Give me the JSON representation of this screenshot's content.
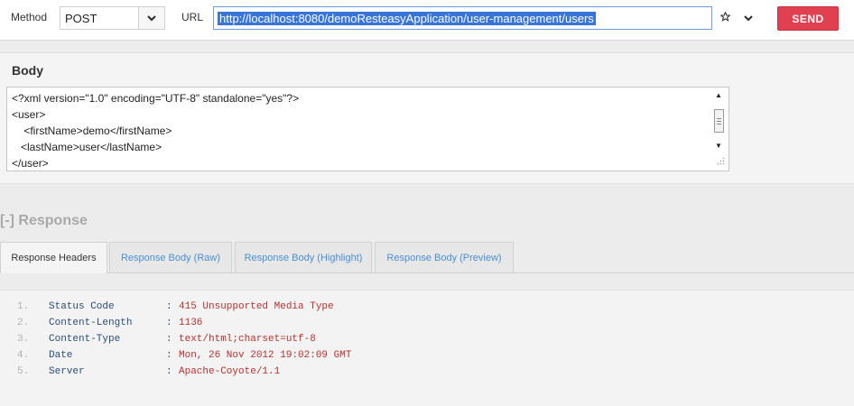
{
  "request": {
    "method_label": "Method",
    "method_value": "POST",
    "url_label": "URL",
    "url_value": "http://localhost:8080/demoResteasyApplication/user-management/users",
    "send_label": "SEND"
  },
  "body": {
    "title": "Body",
    "lines": [
      "<?xml version=\"1.0\" encoding=\"UTF-8\" standalone=\"yes\"?>",
      "<user>",
      "    <firstName>demo</firstName>",
      "   <lastName>user</lastName>",
      "</user>"
    ]
  },
  "response": {
    "title": "[-] Response",
    "tabs": [
      {
        "label": "Response Headers"
      },
      {
        "label": "Response Body (Raw)"
      },
      {
        "label": "Response Body (Highlight)"
      },
      {
        "label": "Response Body (Preview)"
      }
    ],
    "active_tab": "Response Headers",
    "headers": [
      {
        "num": "1.",
        "key": "Status Code",
        "colon": ":",
        "value": "415 Unsupported Media Type"
      },
      {
        "num": "2.",
        "key": "Content-Length",
        "colon": ":",
        "value": "1136"
      },
      {
        "num": "3.",
        "key": "Content-Type",
        "colon": ":",
        "value": "text/html;charset=utf-8"
      },
      {
        "num": "4.",
        "key": "Date",
        "colon": ":",
        "value": "Mon, 26 Nov 2012 19:02:09 GMT"
      },
      {
        "num": "5.",
        "key": "Server",
        "colon": ":",
        "value": "Apache-Coyote/1.1"
      }
    ]
  },
  "colors": {
    "send": "#e0404f",
    "url_highlight": "#3875d7",
    "tab_link": "#4a8fd1",
    "header_key": "#2c4c78",
    "header_value": "#b33131"
  },
  "icons": [
    "chevron-down-icon",
    "star-icon",
    "scrollbar-up-arrow-icon",
    "scrollbar-down-arrow-icon",
    "resize-grip-icon"
  ]
}
